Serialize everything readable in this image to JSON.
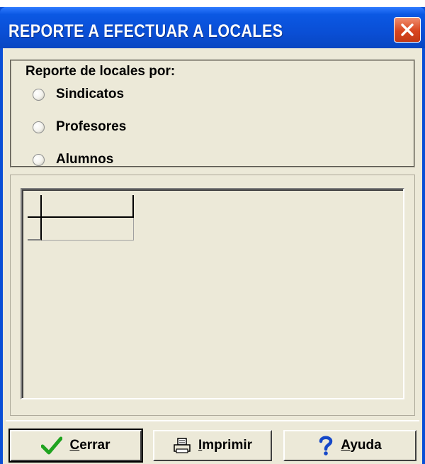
{
  "window": {
    "title": "REPORTE A EFECTUAR A LOCALES"
  },
  "report_group": {
    "legend": "Reporte de locales por:",
    "options": [
      {
        "label": "Sindicatos",
        "selected": false
      },
      {
        "label": "Profesores",
        "selected": false
      },
      {
        "label": "Alumnos",
        "selected": false
      }
    ]
  },
  "buttons": {
    "cerrar": {
      "accel": "C",
      "rest": "errar",
      "icon": "check-icon"
    },
    "imprimir": {
      "accel": "I",
      "rest": "mprimir",
      "icon": "printer-icon"
    },
    "ayuda": {
      "accel": "A",
      "rest": "yuda",
      "icon": "question-icon"
    }
  },
  "colors": {
    "titlebar": "#0a4fd6",
    "client_bg": "#ece9d8",
    "close_button": "#d8451f",
    "check_icon": "#1fa31f",
    "question_icon": "#1648c8"
  }
}
